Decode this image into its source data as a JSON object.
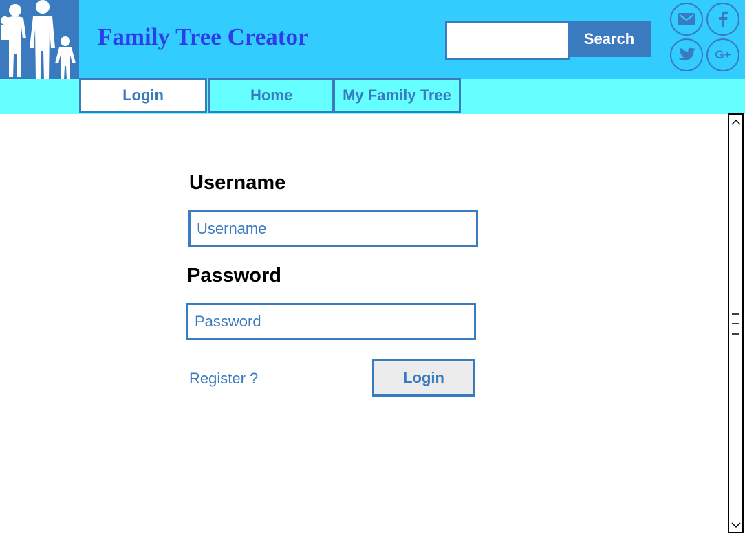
{
  "header": {
    "logo_icon": "family-silhouette-icon",
    "title": "Family Tree Creator",
    "search": {
      "placeholder": "",
      "button_label": "Search"
    },
    "social_icons": [
      "mail-icon",
      "facebook-icon",
      "twitter-icon",
      "google-plus-icon"
    ],
    "google_plus_label": "G+"
  },
  "nav": {
    "tabs": [
      {
        "label": "Login",
        "active": true
      },
      {
        "label": "Home",
        "active": false
      },
      {
        "label": "My Family Tree",
        "active": false
      }
    ]
  },
  "form": {
    "username_label": "Username",
    "username_placeholder": "Username",
    "password_label": "Password",
    "password_placeholder": "Password",
    "register_link": "Register ?",
    "login_button": "Login"
  },
  "colors": {
    "header_bg": "#33ccff",
    "nav_bg": "#66ffff",
    "accent": "#3a7bbf",
    "title": "#2d3ee8"
  }
}
